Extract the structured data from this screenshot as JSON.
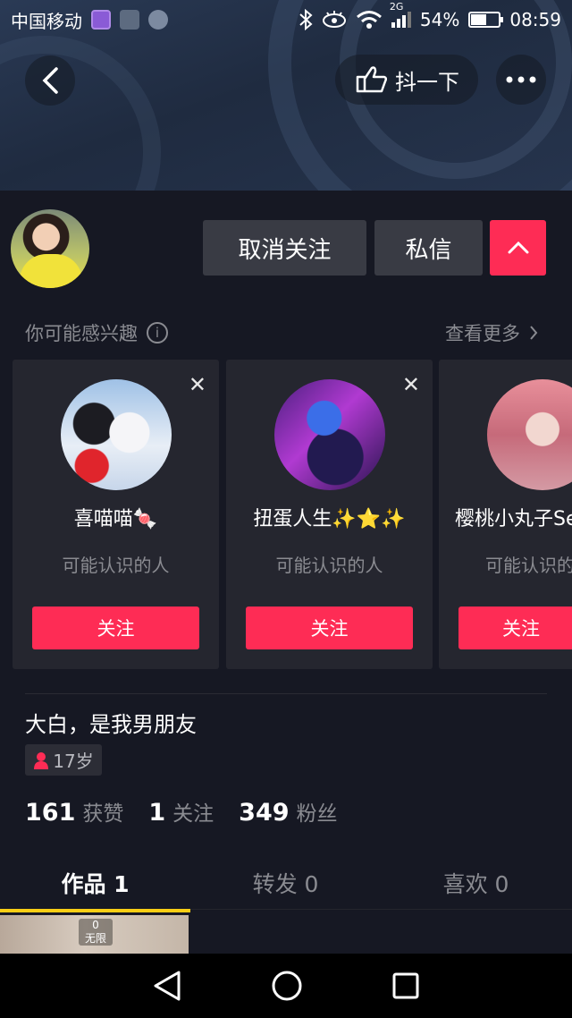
{
  "status_bar": {
    "carrier": "中国移动",
    "network": "2G",
    "battery_percent": "54%",
    "battery_level": 0.54,
    "time": "08:59"
  },
  "header": {
    "shake_label": "抖一下"
  },
  "profile": {
    "unfollow_label": "取消关注",
    "message_label": "私信"
  },
  "recommendations": {
    "title": "你可能感兴趣",
    "see_more": "查看更多",
    "cards": [
      {
        "name": "喜喵喵🍬",
        "subtitle": "可能认识的人",
        "follow_label": "关注"
      },
      {
        "name": "扭蛋人生✨⭐✨",
        "subtitle": "可能认识的人",
        "follow_label": "关注"
      },
      {
        "name": "樱桃小丸子Se",
        "subtitle": "可能认识的",
        "follow_label": "关注"
      }
    ]
  },
  "bio": {
    "signature": "大白，是我男朋友",
    "age": "17岁"
  },
  "stats": [
    {
      "value": "161",
      "label": "获赞"
    },
    {
      "value": "1",
      "label": "关注"
    },
    {
      "value": "349",
      "label": "粉丝"
    }
  ],
  "tabs": [
    {
      "label": "作品 1"
    },
    {
      "label": "转发 0"
    },
    {
      "label": "喜欢 0"
    }
  ],
  "video_thumb": {
    "count": "0",
    "tag": "无限"
  }
}
